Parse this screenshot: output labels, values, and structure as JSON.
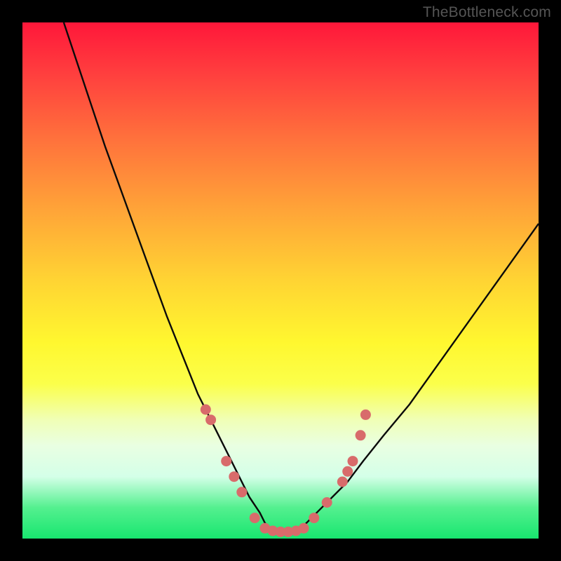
{
  "watermark": "TheBottleneck.com",
  "colors": {
    "curve_stroke": "#0a0a0a",
    "marker_fill": "#d86b6b",
    "marker_stroke": "#d86b6b"
  },
  "chart_data": {
    "type": "line",
    "title": "",
    "xlabel": "",
    "ylabel": "",
    "xlim": [
      0,
      100
    ],
    "ylim": [
      0,
      100
    ],
    "grid": false,
    "legend": false,
    "series": [
      {
        "name": "bottleneck-curve-left",
        "x": [
          8,
          12,
          16,
          20,
          24,
          28,
          32,
          34,
          36,
          38,
          40,
          42,
          44,
          46,
          47,
          48
        ],
        "values": [
          100,
          88,
          76,
          65,
          54,
          43,
          33,
          28,
          24,
          20,
          16,
          12,
          8,
          5,
          3,
          2
        ]
      },
      {
        "name": "bottleneck-curve-flat",
        "x": [
          48,
          49,
          50,
          51,
          52,
          53,
          54
        ],
        "values": [
          2,
          1.5,
          1.3,
          1.2,
          1.3,
          1.5,
          2
        ]
      },
      {
        "name": "bottleneck-curve-right",
        "x": [
          54,
          56,
          58,
          60,
          63,
          66,
          70,
          75,
          80,
          85,
          90,
          95,
          100
        ],
        "values": [
          2,
          4,
          6,
          8,
          11,
          15,
          20,
          26,
          33,
          40,
          47,
          54,
          61
        ]
      }
    ],
    "markers": {
      "name": "highlight-points",
      "points": [
        {
          "x": 35.5,
          "y": 25
        },
        {
          "x": 36.5,
          "y": 23
        },
        {
          "x": 39.5,
          "y": 15
        },
        {
          "x": 41,
          "y": 12
        },
        {
          "x": 42.5,
          "y": 9
        },
        {
          "x": 45,
          "y": 4
        },
        {
          "x": 47,
          "y": 2
        },
        {
          "x": 48.5,
          "y": 1.5
        },
        {
          "x": 50,
          "y": 1.3
        },
        {
          "x": 51.5,
          "y": 1.3
        },
        {
          "x": 53,
          "y": 1.5
        },
        {
          "x": 54.5,
          "y": 2
        },
        {
          "x": 56.5,
          "y": 4
        },
        {
          "x": 59,
          "y": 7
        },
        {
          "x": 62,
          "y": 11
        },
        {
          "x": 63,
          "y": 13
        },
        {
          "x": 64,
          "y": 15
        },
        {
          "x": 65.5,
          "y": 20
        },
        {
          "x": 66.5,
          "y": 24
        }
      ]
    }
  }
}
